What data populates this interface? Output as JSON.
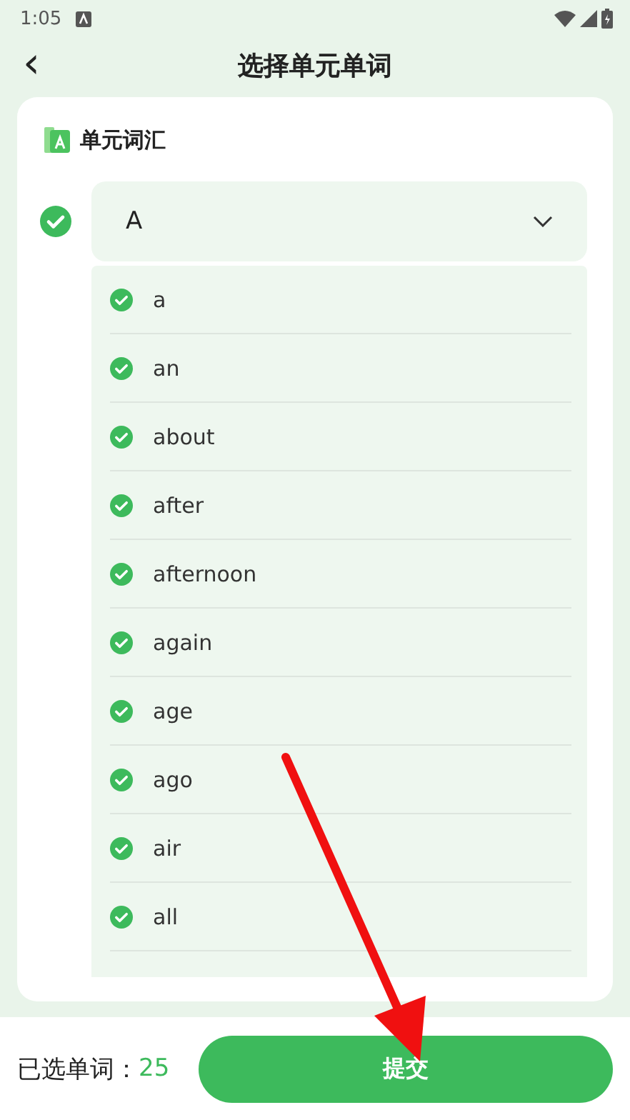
{
  "status_bar": {
    "time": "1:05"
  },
  "header": {
    "back": "‹",
    "title": "选择单元单词"
  },
  "section": {
    "title": "单元词汇"
  },
  "unit": {
    "name": "A",
    "checked": true
  },
  "words": [
    {
      "word": "a",
      "checked": true
    },
    {
      "word": "an",
      "checked": true
    },
    {
      "word": "about",
      "checked": true
    },
    {
      "word": "after",
      "checked": true
    },
    {
      "word": "afternoon",
      "checked": true
    },
    {
      "word": "again",
      "checked": true
    },
    {
      "word": "age",
      "checked": true
    },
    {
      "word": "ago",
      "checked": true
    },
    {
      "word": "air",
      "checked": true
    },
    {
      "word": "all",
      "checked": true
    }
  ],
  "footer": {
    "label": "已选单词：",
    "count": "25",
    "submit": "提交"
  }
}
